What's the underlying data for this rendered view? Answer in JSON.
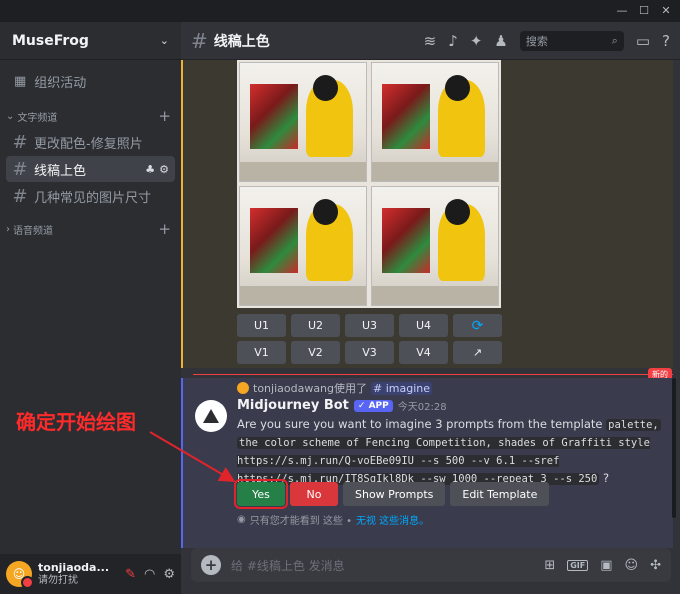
{
  "window": {
    "controls": [
      "—",
      "☐",
      "✕"
    ]
  },
  "sidebar": {
    "server_name": "MuseFrog",
    "events_label": "组织活动",
    "text_category": "文字频道",
    "voice_category": "语音频道",
    "channels": [
      {
        "label": "更改配色-修复照片"
      },
      {
        "label": "线稿上色"
      },
      {
        "label": "几种常见的图片尺寸"
      }
    ]
  },
  "user": {
    "name": "tonjiaoda...",
    "status": "请勿打扰"
  },
  "header": {
    "channel": "线稿上色",
    "search_placeholder": "搜索"
  },
  "grid_buttons": {
    "upscale": [
      "U1",
      "U2",
      "U3",
      "U4"
    ],
    "variation": [
      "V1",
      "V2",
      "V3",
      "V4"
    ]
  },
  "new_badge": "新的",
  "message": {
    "reply_user": "tonjiaodawang使用了",
    "reply_command": "imagine",
    "author": "Midjourney Bot",
    "app_badge": "APP",
    "time": "今天02:28",
    "text_intro": "Are you sure you want to imagine 3 prompts from the template",
    "code1": "palette,",
    "code2": "the color scheme of Fencing Competition, shades of Graffiti style https://s.mj.run/Q-voEBe09IU --s 500 --v 6.1 --sref https://s.mj.run/IT8SqIkl8Dk --sw 1000 --repeat 3  --s 250",
    "text_end": "?",
    "yes": "Yes",
    "no": "No",
    "show_prompts": "Show Prompts",
    "edit_template": "Edit Template",
    "ephemeral_text": "只有您才能看到 这些 •",
    "ephemeral_link": "无视 这些消息。"
  },
  "composer": {
    "placeholder": "给 #线稿上色 发消息"
  },
  "annotation": {
    "text": "确定开始绘图",
    "color": "#ff2a2a"
  },
  "colors": {
    "accent": "#5865f2",
    "yes": "#248046",
    "no": "#da373c",
    "mention": "#f0b232"
  }
}
